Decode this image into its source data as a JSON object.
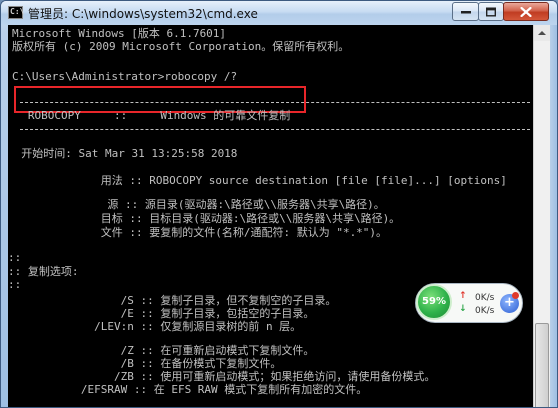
{
  "window": {
    "title": "管理员: C:\\windows\\system32\\cmd.exe",
    "app_icon_text": "C:\\"
  },
  "console": {
    "lines": [
      "Microsoft Windows [版本 6.1.7601]",
      "版权所有 (c) 2009 Microsoft Corporation。保留所有权利。",
      "C:\\Users\\Administrator>robocopy /?",
      "   ROBOCOPY     ::     Windows 的可靠文件复制",
      "  开始时间: Sat Mar 31 13:25:58 2018",
      "              用法 :: ROBOCOPY source destination [file [file]...] [options]",
      "               源 :: 源目录(驱动器:\\路径或\\\\服务器\\共享\\路径)。",
      "              目标 :: 目标目录(驱动器:\\路径或\\\\服务器\\共享\\路径)。",
      "              文件 :: 要复制的文件(名称/通配符: 默认为 \"*.*\")。",
      "::",
      ":: 复制选项:",
      "::",
      "                 /S :: 复制子目录，但不复制空的子目录。",
      "                 /E :: 复制子目录，包括空的子目录。",
      "             /LEV:n :: 仅复制源目录树的前 n 层。",
      "                 /Z :: 在可重新启动模式下复制文件。",
      "                 /B :: 在备份模式下复制文件。",
      "                /ZB :: 使用可重新启动模式；如果拒绝访问，请使用备份模式。",
      "           /EFSRAW :: 在 EFS RAW 模式下复制所有加密的文件。"
    ]
  },
  "net_widget": {
    "percent": "59%",
    "upload": "0K/s",
    "download": "0K/s",
    "boost_symbol": "+"
  },
  "colors": {
    "console_bg": "#000000",
    "console_text": "#c0c0c0",
    "highlight_border": "#e8262a",
    "gauge_green": "#2fb24a"
  }
}
